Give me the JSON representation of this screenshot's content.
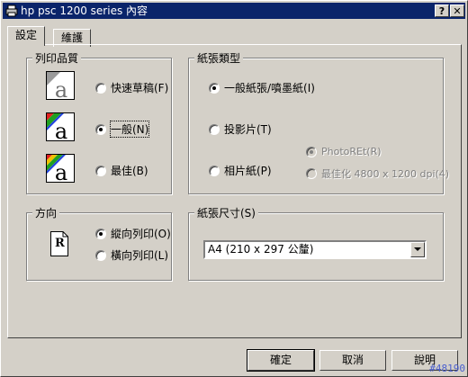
{
  "window": {
    "title": "hp psc 1200 series 內容",
    "help_label": "?",
    "close_label": "✕"
  },
  "tabs": [
    {
      "label": "設定"
    },
    {
      "label": "維護"
    }
  ],
  "quality": {
    "label": "列印品質",
    "options": [
      {
        "label": "快速草稿(F)",
        "checked": false,
        "icon": "draft-quality-icon"
      },
      {
        "label": "一般(N)",
        "checked": true,
        "icon": "normal-quality-icon"
      },
      {
        "label": "最佳(B)",
        "checked": false,
        "icon": "best-quality-icon"
      }
    ]
  },
  "paper_type": {
    "label": "紙張類型",
    "options": [
      {
        "label": "一般紙張/噴墨紙(I)",
        "checked": true
      },
      {
        "label": "投影片(T)",
        "checked": false
      },
      {
        "label": "相片紙(P)",
        "checked": false
      }
    ],
    "sub_options": [
      {
        "label": "PhotoREt(R)",
        "checked": true,
        "enabled": false
      },
      {
        "label": "最佳化 4800 x 1200 dpi(4)",
        "checked": false,
        "enabled": false
      }
    ]
  },
  "orientation": {
    "label": "方向",
    "icon_letter": "R",
    "options": [
      {
        "label": "縱向列印(O)",
        "checked": true
      },
      {
        "label": "橫向列印(L)",
        "checked": false
      }
    ]
  },
  "paper_size": {
    "label": "紙張尺寸(S)",
    "value": "A4 (210 x 297 公釐)"
  },
  "buttons": {
    "ok": "確定",
    "cancel": "取消",
    "help": "說明"
  },
  "watermark": "#48190",
  "colors": {
    "titlebar": "#0a246a",
    "face": "#d4d0c8"
  }
}
